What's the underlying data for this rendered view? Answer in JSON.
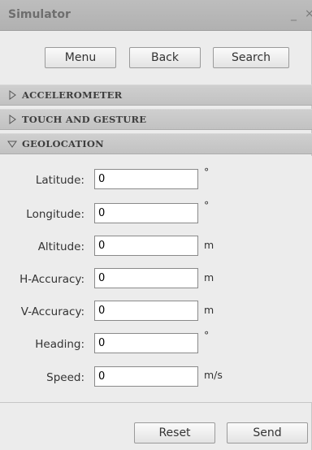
{
  "window": {
    "title": "Simulator",
    "minimize_label": "_",
    "close_label": "×"
  },
  "nav": {
    "menu_label": "Menu",
    "back_label": "Back",
    "search_label": "Search"
  },
  "sections": [
    {
      "label": "ACCELEROMETER",
      "state": "collapsed"
    },
    {
      "label": "TOUCH AND GESTURE",
      "state": "collapsed"
    },
    {
      "label": "GEOLOCATION",
      "state": "expanded"
    }
  ],
  "geolocation": {
    "fields": [
      {
        "label": "Latitude:",
        "value": "0",
        "unit": "°"
      },
      {
        "label": "Longitude:",
        "value": "0",
        "unit": "°"
      },
      {
        "label": "Altitude:",
        "value": "0",
        "unit": "m"
      },
      {
        "label": "H-Accuracy:",
        "value": "0",
        "unit": "m"
      },
      {
        "label": "V-Accuracy:",
        "value": "0",
        "unit": "m"
      },
      {
        "label": "Heading:",
        "value": "0",
        "unit": "°"
      },
      {
        "label": "Speed:",
        "value": "0",
        "unit": "m/s"
      }
    ],
    "reset_label": "Reset",
    "send_label": "Send"
  },
  "colors": {
    "panel_bg": "#ececec",
    "header_bg": "#c6c6c6",
    "title_bar_bg": "#b7b7b7"
  },
  "icons": {
    "collapsed": "triangle-right-icon",
    "expanded": "triangle-down-icon"
  }
}
